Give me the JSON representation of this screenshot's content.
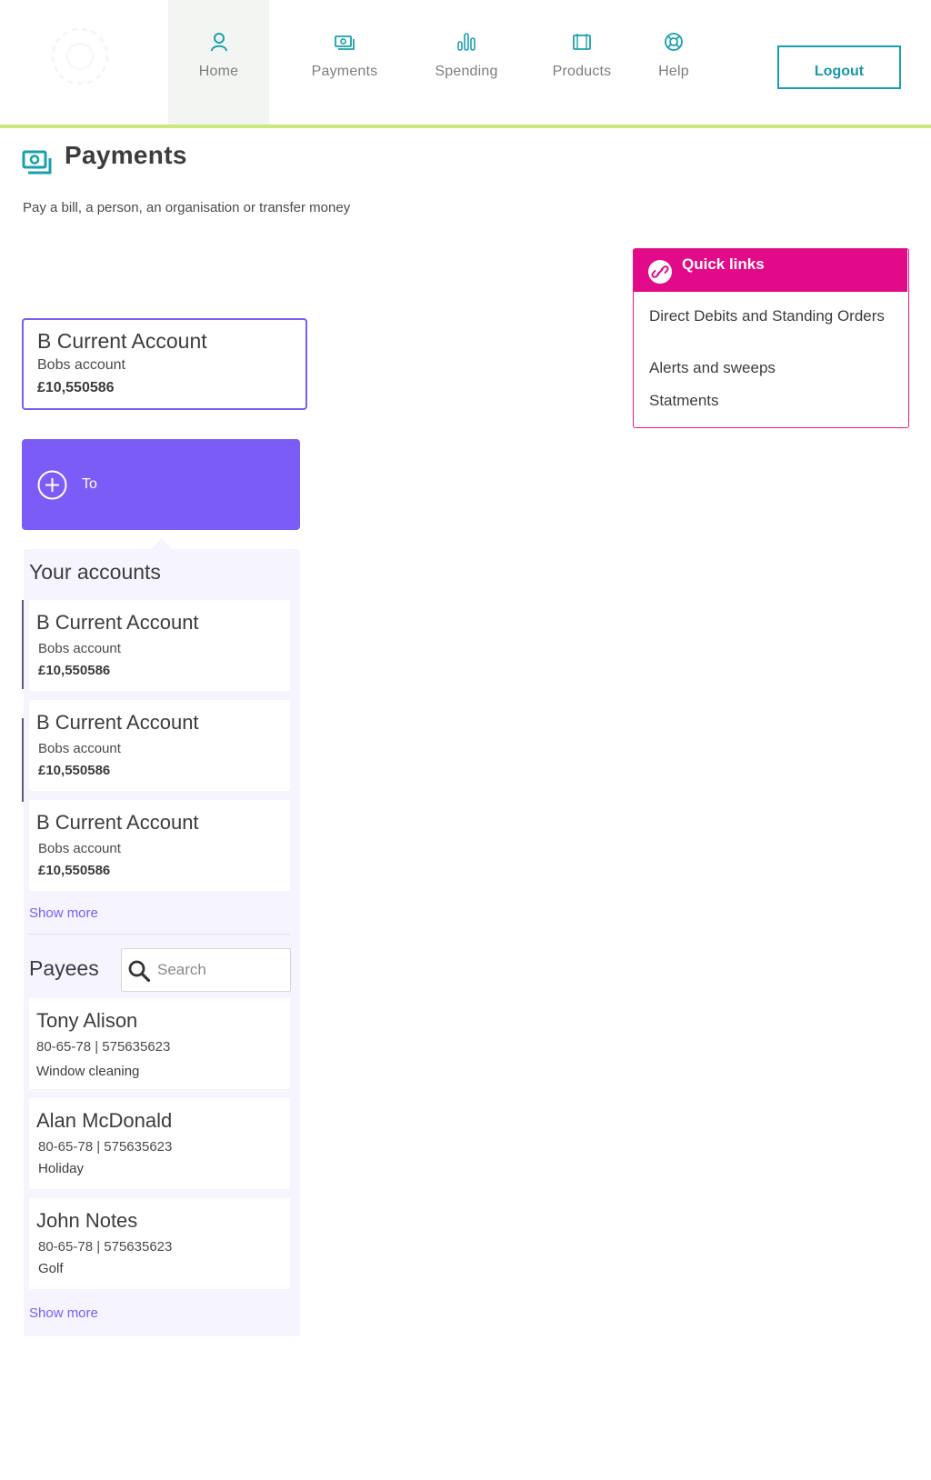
{
  "nav": {
    "items": [
      {
        "label": "Home",
        "icon": "person-icon",
        "active": true
      },
      {
        "label": "Payments",
        "icon": "cash-icon"
      },
      {
        "label": "Spending",
        "icon": "bar-chart-icon"
      },
      {
        "label": "Products",
        "icon": "products-icon"
      },
      {
        "label": "Help",
        "icon": "lifebuoy-icon"
      }
    ],
    "logout_label": "Logout"
  },
  "colors": {
    "accent_teal": "#1aa0ad",
    "accent_purple": "#7b5cf6",
    "accent_magenta": "#e20a88",
    "nav_underline": "#cbe87b"
  },
  "page": {
    "title": "Payments",
    "subtitle": "Pay a bill, a person, an organisation or transfer money"
  },
  "from_account": {
    "name": "B Current Account",
    "nickname": "Bobs account",
    "balance": "£10,550586"
  },
  "to_button": {
    "label": "To"
  },
  "your_accounts": {
    "title": "Your accounts",
    "items": [
      {
        "name": "B Current Account",
        "nickname": "Bobs account",
        "balance": "£10,550586"
      },
      {
        "name": "B Current Account",
        "nickname": "Bobs account",
        "balance": "£10,550586"
      },
      {
        "name": "B Current Account",
        "nickname": "Bobs account",
        "balance": "£10,550586"
      }
    ],
    "show_more": "Show more"
  },
  "payees": {
    "title": "Payees",
    "search_placeholder": "Search",
    "items": [
      {
        "name": "Tony Alison",
        "details": "80-65-78 | 575635623",
        "reference": "Window cleaning"
      },
      {
        "name": "Alan McDonald",
        "details": "80-65-78 | 575635623",
        "reference": "Holiday"
      },
      {
        "name": "John Notes",
        "details": "80-65-78 | 575635623",
        "reference": "Golf"
      }
    ],
    "show_more": "Show more"
  },
  "quick_links": {
    "title": "Quick links",
    "links": [
      "Direct Debits and Standing Orders",
      "Alerts and sweeps",
      "Statments"
    ]
  }
}
